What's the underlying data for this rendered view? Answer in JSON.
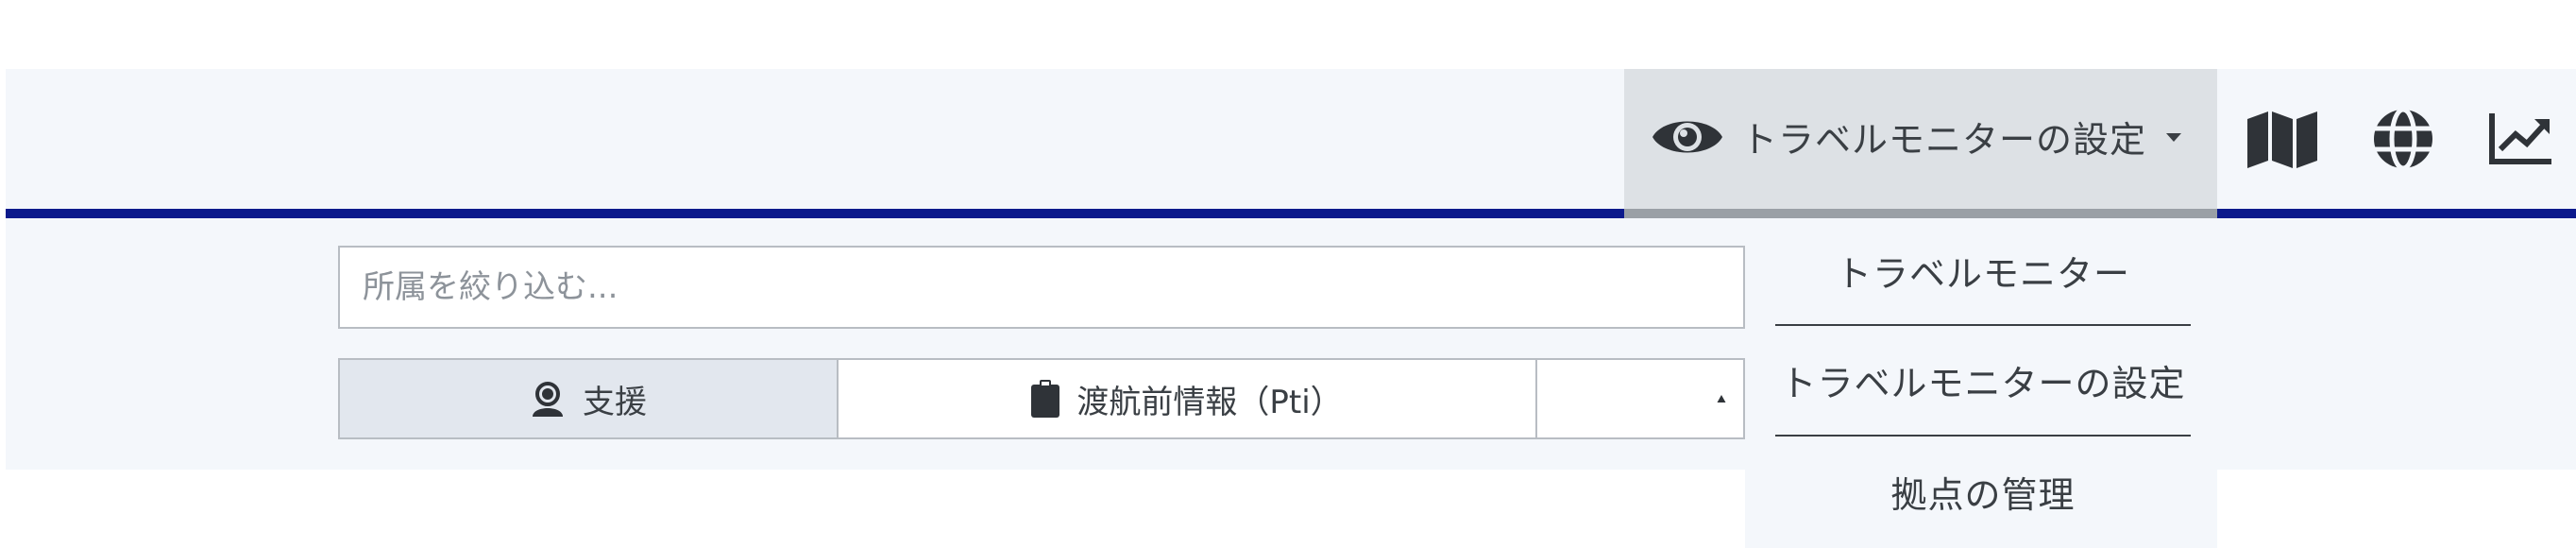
{
  "header": {
    "settings_label": "トラベルモニターの設定",
    "icons": [
      "eye-icon",
      "caret-down-icon",
      "map-icon",
      "globe-icon",
      "chart-line-icon"
    ]
  },
  "dropdown": {
    "items": [
      {
        "label": "トラベルモニター"
      },
      {
        "label": "トラベルモニターの設定"
      },
      {
        "label": "拠点の管理"
      }
    ]
  },
  "filter": {
    "placeholder": "所属を絞り込む..."
  },
  "tabs": [
    {
      "label": "支援",
      "icon": "user-headset-icon",
      "selected": true
    },
    {
      "label": "渡航前情報（Pti）",
      "icon": "clipboard-icon",
      "selected": false
    },
    {
      "label": "",
      "icon": "warning-icon",
      "selected": false
    }
  ],
  "colors": {
    "accent_navy": "#0c1a8c",
    "background": "#f4f7fb",
    "active_menu": "#dde1e5",
    "text": "#3a3f44"
  }
}
